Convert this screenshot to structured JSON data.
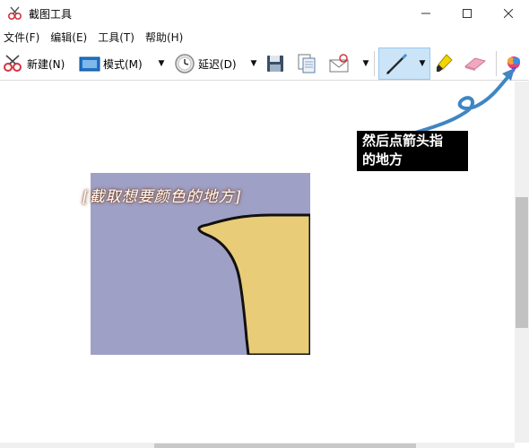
{
  "window": {
    "title": "截图工具",
    "minimize_glyph": "—",
    "maximize_glyph": "☐",
    "close_glyph": "✕"
  },
  "menu": {
    "items": [
      "文件(F)",
      "编辑(E)",
      "工具(T)",
      "帮助(H)"
    ]
  },
  "toolbar": {
    "new_label": "新建(N)",
    "mode_label": "模式(M)",
    "delay_label": "延迟(D)",
    "icons": {
      "new": "scissors-icon",
      "mode": "rectangle-mode-icon",
      "delay": "clock-icon",
      "save": "save-icon",
      "copy": "copy-icon",
      "send": "send-email-icon",
      "pen": "pen-icon",
      "highlighter": "highlighter-icon",
      "eraser": "eraser-icon",
      "paint3d": "paint-3d-icon"
    },
    "active_tool": "pen"
  },
  "canvas": {
    "caption": "[截取想要颜色的地方]",
    "colors": {
      "purple": "#9fa0c6",
      "yellow": "#e9cc78",
      "outline": "#111111"
    }
  },
  "annotation": {
    "text_line1": "然后点箭头指",
    "text_line2": "的地方",
    "arrow_color": "#3f86c2"
  }
}
